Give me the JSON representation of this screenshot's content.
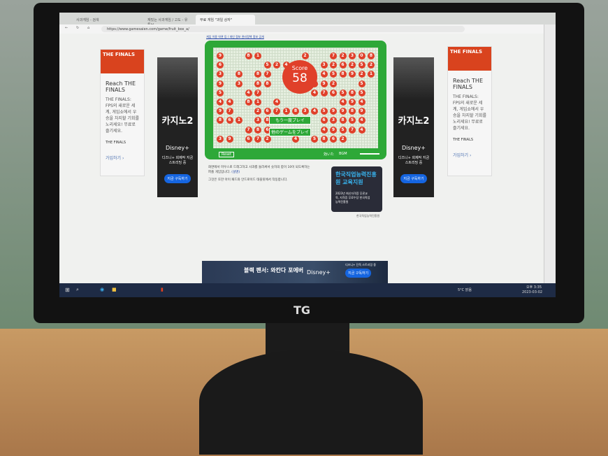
{
  "browser": {
    "tabs": [
      "사과게임 - 검색",
      "재밌는 사과게임 / 고도 - 유튜브",
      "무료 게임 \"과일 상자\""
    ],
    "url": "https://www.gamesaien.com/game/fruit_box_a/"
  },
  "page": {
    "top_links": "게임 이용 약관 등 / 개인 정보 관리정책 정보 공개",
    "description1": "화면에서 마우스로 드래그하고 사과를 둘러싸서 숫자의 합이 10이 되도록하는 퍼즐 게임입니다.",
    "description_link": "(설명)",
    "description2": "그것은 또한 아이 패드와 안드로이드 태블릿에서 작동합니다."
  },
  "game": {
    "score_label": "Score",
    "score": "58",
    "play_again": "もう一度プレイ",
    "other_games": "他のゲームをプレイ",
    "reset": "Reset",
    "option1": "効いた",
    "option2": "BGM",
    "rows": [
      "9..81....2..72308",
      "6....524...326252",
      "3.8.87.....458921",
      "9.3.88....992..5.",
      "5..47.....476585.",
      "44.81.4......494.",
      "97..267183459989.",
      "861.38.....63854.",
      "...786.....49574.",
      "39.672..4.5862..."
    ]
  },
  "ads": {
    "finals_logo": "THE FINALS",
    "finals_title": "Reach THE FINALS",
    "finals_body": "THE FINALS: FPS의 새로운 세계, 게임쇼에서 우승을 차지할 기회를 노리세요! 무료로 즐기세요.",
    "finals_brand": "THE FINALS",
    "finals_cta": "가입하기 ›",
    "casino_title": "카지노2",
    "disney": "Disney+",
    "disney_text": "디즈니+ 회제작 지금 스트리밍 중",
    "disney_cta": "지금 구독하기",
    "hrd_title": "한국직업능력진흥원 교육지원",
    "hrd_body": "2023년 최신자격증 무료교육, 지격증 무료수당 한국직업능력진흥원",
    "hrd_footer": "한국직업능력진흥원",
    "banner_title": "블랙 팬서: 와칸다 포에버",
    "banner_text": "디즈니+ 단독 스트리밍 중",
    "banner_cta": "지금 구독하기"
  },
  "taskbar": {
    "weather": "5°C 맑음",
    "time": "오후 3:35",
    "date": "2023-03-02"
  },
  "monitor": {
    "brand": "TG"
  }
}
